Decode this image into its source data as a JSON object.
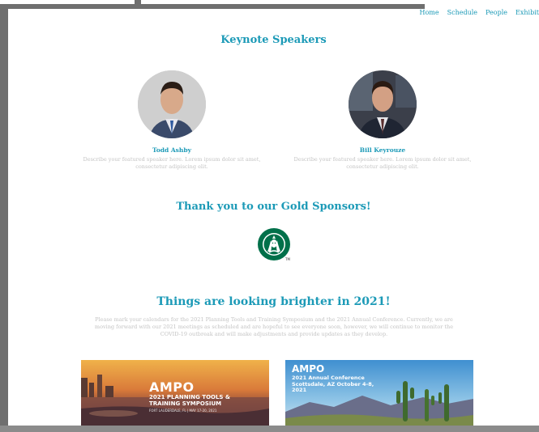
{
  "nav": {
    "items": [
      "Home",
      "Schedule",
      "People",
      "Exhibit"
    ]
  },
  "keynote": {
    "heading": "Keynote Speakers",
    "speakers": [
      {
        "name": "Todd Ashby",
        "description": "Describe your featured speaker here. Lorem ipsum dolor sit amet, consectetur adipiscing elit."
      },
      {
        "name": "Bill Keyrouze",
        "description": "Describe your featured speaker here. Lorem ipsum dolor sit amet, consectetur adipiscing elit."
      }
    ]
  },
  "sponsors": {
    "heading": "Thank you to our Gold Sponsors!",
    "logo_tm": "TM"
  },
  "announcement": {
    "heading": "Things are looking brighter in 2021!",
    "body": "Please mark your calendars for the 2021 Planning Tools and Training Symposium and the 2021 Annual Conference. Currently, we are moving forward with our 2021 meetings as scheduled and are hopeful to see everyone soon, however, we will continue to monitor the COVID-19 outbreak and will make adjustments and provide updates as they develop."
  },
  "events": [
    {
      "title": "AMPO",
      "subtitle": "2021 PLANNING TOOLS & TRAINING SYMPOSIUM",
      "date": "FORT LAUDERDALE, FL | MAY 17-20, 2021"
    },
    {
      "title": "AMPO",
      "subtitle": "2021 Annual Conference Scottsdale, AZ October 4-8, 2021"
    }
  ],
  "colors": {
    "accent": "#1c9ab7",
    "muted_text": "#c4c4c4",
    "frame": "#6f6f6f",
    "starbucks_green": "#00704a"
  }
}
